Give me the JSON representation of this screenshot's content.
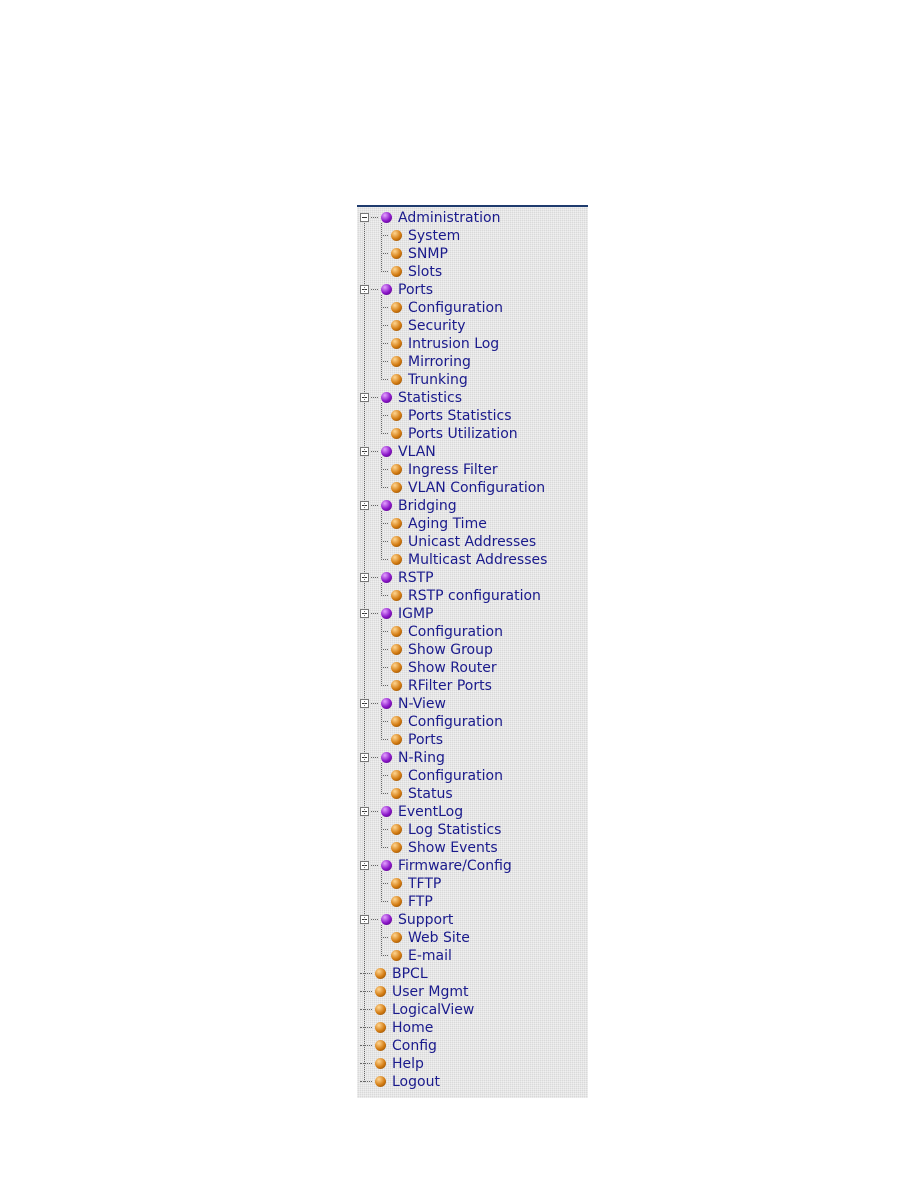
{
  "tree": [
    {
      "label": "Administration",
      "children": [
        "System",
        "SNMP",
        "Slots"
      ]
    },
    {
      "label": "Ports",
      "children": [
        "Configuration",
        "Security",
        "Intrusion Log",
        "Mirroring",
        "Trunking"
      ]
    },
    {
      "label": "Statistics",
      "children": [
        "Ports Statistics",
        "Ports Utilization"
      ]
    },
    {
      "label": "VLAN",
      "children": [
        "Ingress Filter",
        "VLAN Configuration"
      ]
    },
    {
      "label": "Bridging",
      "children": [
        "Aging Time",
        "Unicast Addresses",
        "Multicast Addresses"
      ]
    },
    {
      "label": "RSTP",
      "children": [
        "RSTP configuration"
      ]
    },
    {
      "label": "IGMP",
      "children": [
        "Configuration",
        "Show Group",
        "Show Router",
        "RFilter Ports"
      ]
    },
    {
      "label": "N-View",
      "children": [
        "Configuration",
        "Ports"
      ]
    },
    {
      "label": "N-Ring",
      "children": [
        "Configuration",
        "Status"
      ]
    },
    {
      "label": "EventLog",
      "children": [
        "Log Statistics",
        "Show Events"
      ]
    },
    {
      "label": "Firmware/Config",
      "children": [
        "TFTP",
        "FTP"
      ]
    },
    {
      "label": "Support",
      "children": [
        "Web Site",
        "E-mail"
      ]
    }
  ],
  "links": [
    "BPCL",
    "User Mgmt",
    "LogicalView",
    "Home",
    "Config",
    "Help",
    "Logout"
  ]
}
